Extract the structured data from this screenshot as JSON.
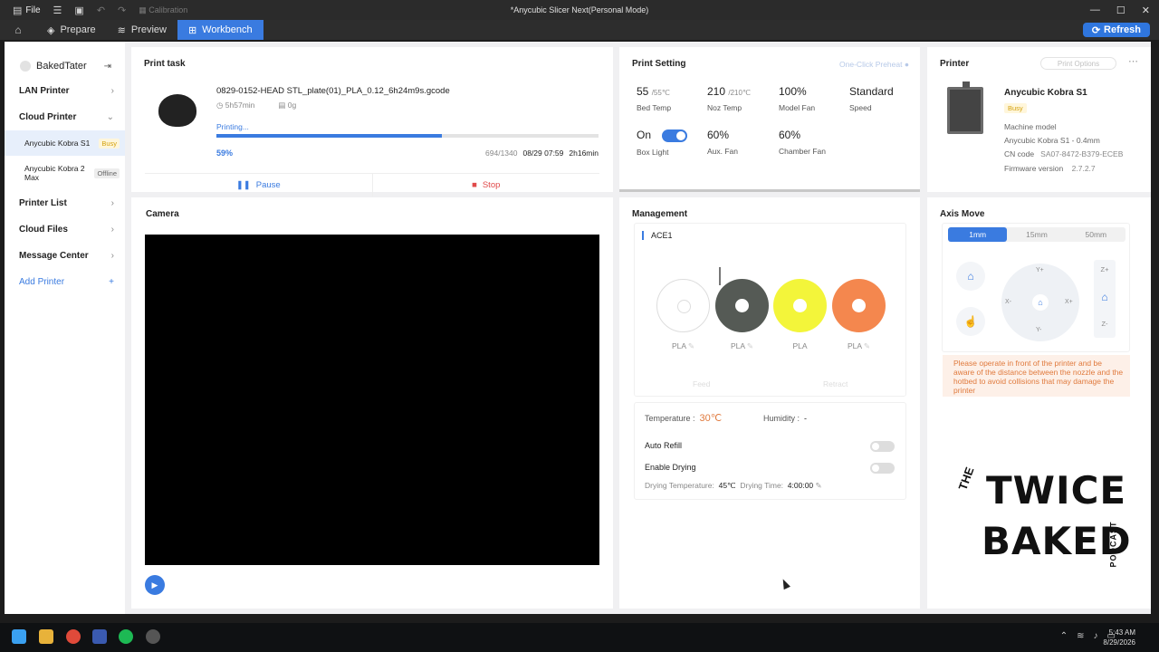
{
  "titlebar": {
    "file_label": "File",
    "calibration_label": "Calibration",
    "window_title": "*Anycubic Slicer Next(Personal Mode)"
  },
  "nav": {
    "tabs": [
      {
        "label": "Prepare"
      },
      {
        "label": "Preview"
      },
      {
        "label": "Workbench"
      }
    ],
    "refresh_label": "Refresh"
  },
  "sidebar": {
    "username": "BakedTater",
    "lan_printer": "LAN Printer",
    "cloud_printer": "Cloud Printer",
    "printers": [
      {
        "name": "Anycubic Kobra S1",
        "status": "Busy"
      },
      {
        "name": "Anycubic Kobra 2 Max",
        "status": "Offline"
      }
    ],
    "printer_list": "Printer List",
    "cloud_files": "Cloud Files",
    "message_center": "Message Center",
    "add_printer": "Add Printer"
  },
  "print_task": {
    "title": "Print task",
    "filename": "0829-0152-HEAD STL_plate(01)_PLA_0.12_6h24m9s.gcode",
    "duration": "5h57min",
    "weight": "0g",
    "status": "Printing...",
    "progress_fraction": 0.59,
    "percent": "59%",
    "layers": "694/1340",
    "eta": "08/29 07:59",
    "remaining": "2h16min",
    "pause_label": "Pause",
    "stop_label": "Stop"
  },
  "print_setting": {
    "title": "Print Setting",
    "one_click_preheat": "One-Click Preheat",
    "bed_temp": {
      "value": "55",
      "target": "/55℃",
      "label": "Bed Temp"
    },
    "noz_temp": {
      "value": "210",
      "target": "/210℃",
      "label": "Noz Temp"
    },
    "model_fan": {
      "value": "100%",
      "label": "Model Fan"
    },
    "speed": {
      "value": "Standard",
      "label": "Speed"
    },
    "box_light": {
      "value": "On",
      "label": "Box Light"
    },
    "aux_fan": {
      "value": "60%",
      "label": "Aux. Fan"
    },
    "chamber_fan": {
      "value": "60%",
      "label": "Chamber Fan"
    }
  },
  "printer": {
    "title": "Printer",
    "print_options": "Print Options",
    "name": "Anycubic Kobra S1",
    "status": "Busy",
    "machine_model_label": "Machine model",
    "machine_model": "Anycubic Kobra S1 - 0.4mm",
    "cn_code_label": "CN code",
    "cn_code": "SA07-8472-B379-ECEB",
    "firmware_label": "Firmware version",
    "firmware": "2.7.2.7"
  },
  "camera": {
    "title": "Camera"
  },
  "management": {
    "title": "Management",
    "ace_title": "ACE1",
    "spools": [
      {
        "label": "PLA",
        "color": "#ffffff"
      },
      {
        "label": "PLA",
        "color": "#555a55"
      },
      {
        "label": "PLA",
        "color": "#f3f53a"
      },
      {
        "label": "PLA",
        "color": "#f4874e"
      }
    ],
    "feed_label": "Feed",
    "retract_label": "Retract",
    "temperature_label": "Temperature :",
    "temperature_value": "30℃",
    "humidity_label": "Humidity :",
    "humidity_value": "-",
    "auto_refill": "Auto Refill",
    "enable_drying": "Enable Drying",
    "drying_temp_label": "Drying Temperature:",
    "drying_temp": "45℃",
    "drying_time_label": "Drying Time:",
    "drying_time": "4:00:00"
  },
  "axis_move": {
    "title": "Axis Move",
    "steps": [
      "1mm",
      "15mm",
      "50mm"
    ],
    "y_plus": "Y+",
    "y_minus": "Y-",
    "x_plus": "X+",
    "x_minus": "X-",
    "z_plus": "Z+",
    "z_minus": "Z-",
    "warning": "Please operate in front of the printer and be aware of the distance between the nozzle and the hotbed to avoid collisions that may damage the printer"
  },
  "logo": {
    "the": "THE",
    "twice": "TWICE",
    "baked": "BAKED",
    "podcast": "PODCAST"
  },
  "taskbar": {
    "time": "5:43 AM",
    "date": "8/29/2026"
  }
}
